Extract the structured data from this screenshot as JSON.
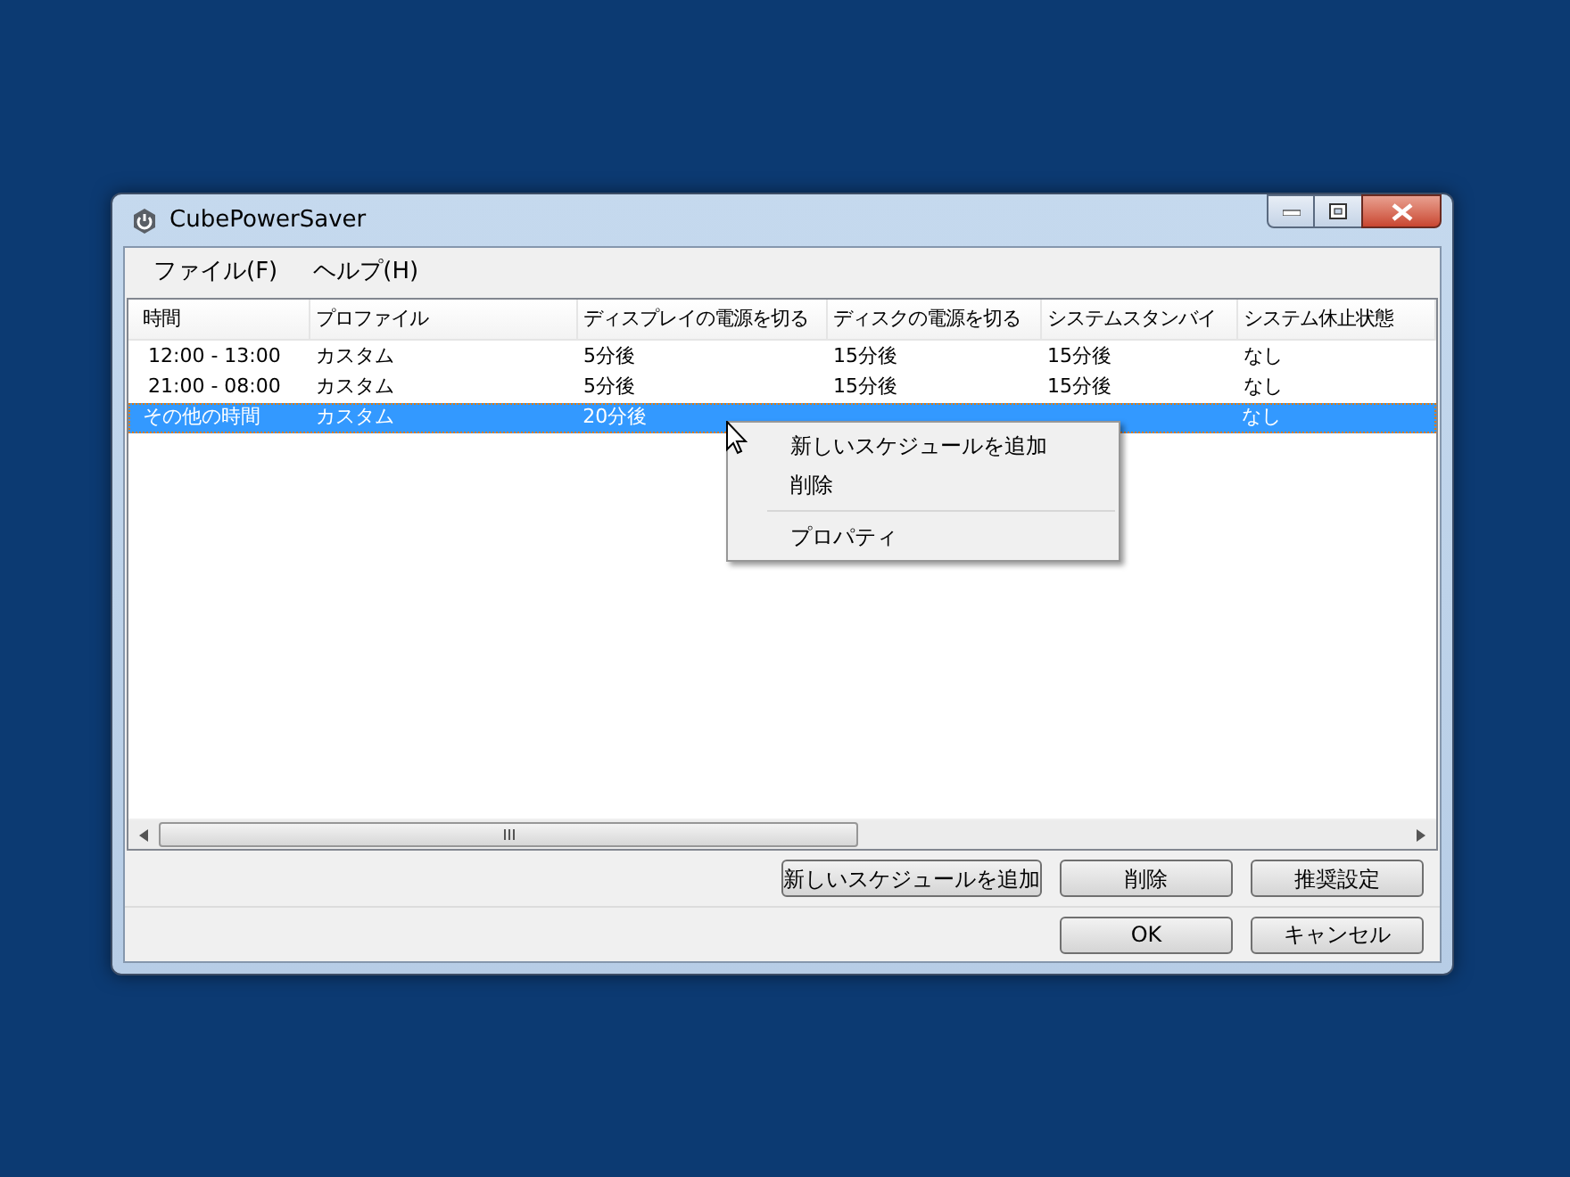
{
  "window": {
    "title": "CubePowerSaver"
  },
  "menu_bar": [
    "ファイル(F)",
    "ヘルプ(H)"
  ],
  "table": {
    "columns": [
      "時間",
      "プロファイル",
      "ディスプレイの電源を切る",
      "ディスクの電源を切る",
      "システムスタンバイ",
      "システム休止状態"
    ],
    "rows": [
      {
        "cells": [
          "12:00 - 13:00",
          "カスタム",
          "5分後",
          "15分後",
          "15分後",
          "なし"
        ],
        "selected": false
      },
      {
        "cells": [
          "21:00 - 08:00",
          "カスタム",
          "5分後",
          "15分後",
          "15分後",
          "なし"
        ],
        "selected": false
      },
      {
        "cells": [
          "その他の時間",
          "カスタム",
          "20分後",
          null,
          null,
          "なし"
        ],
        "selected": true
      }
    ]
  },
  "context_menu": [
    {
      "kind": "item",
      "label": "新しいスケジュールを追加"
    },
    {
      "kind": "item",
      "label": "削除"
    },
    {
      "kind": "separator"
    },
    {
      "kind": "item",
      "label": "プロパティ"
    }
  ],
  "action_buttons": [
    "新しいスケジュールを追加",
    "削除",
    "推奨設定"
  ],
  "dialog_buttons": [
    "OK",
    "キャンセル"
  ]
}
